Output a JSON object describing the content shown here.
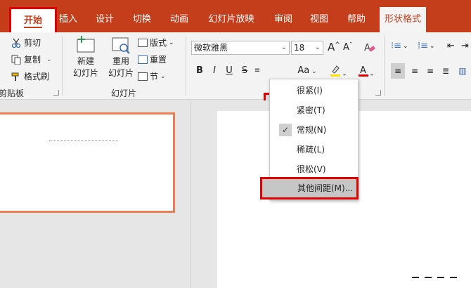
{
  "tabs": [
    {
      "label": "开始"
    },
    {
      "label": "插入"
    },
    {
      "label": "设计"
    },
    {
      "label": "切换"
    },
    {
      "label": "动画"
    },
    {
      "label": "幻灯片放映"
    },
    {
      "label": "审阅"
    },
    {
      "label": "视图"
    },
    {
      "label": "帮助"
    },
    {
      "label": "形状格式"
    }
  ],
  "clipboard": {
    "cut": "剪切",
    "copy": "复制",
    "painter": "格式刷",
    "group": "剪贴板"
  },
  "slides": {
    "new_line1": "新建",
    "new_line2": "幻灯片",
    "reuse_line1": "重用",
    "reuse_line2": "幻灯片",
    "layout": "版式",
    "reset": "重置",
    "section": "节",
    "group": "幻灯片"
  },
  "font": {
    "name": "微软雅黑",
    "size": "18",
    "bold": "B",
    "italic": "I",
    "underline": "U",
    "strike": "S",
    "spacing": "AV",
    "case": "Aa",
    "grow": "A",
    "shrink": "A"
  },
  "spacing_menu": {
    "items": [
      {
        "label": "很紧(I)"
      },
      {
        "label": "紧密(T)"
      },
      {
        "label": "常规(N)"
      },
      {
        "label": "稀疏(L)"
      },
      {
        "label": "很松(V)"
      },
      {
        "label": "其他间距(M)..."
      }
    ],
    "checked": "常规(N)"
  },
  "colors": {
    "accent": "#c43e1c",
    "highlight": "#e00000",
    "thumb_border": "#ed7d52"
  }
}
